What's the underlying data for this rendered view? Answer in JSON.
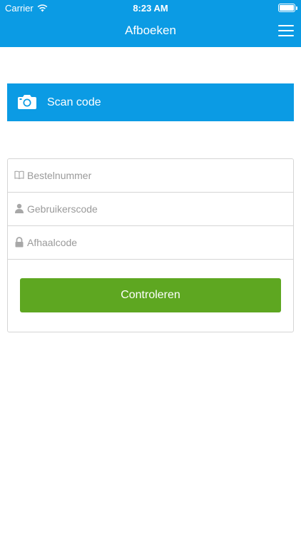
{
  "status_bar": {
    "carrier": "Carrier",
    "time": "8:23 AM",
    "wifi_icon": "wifi-icon",
    "battery_icon": "battery-icon"
  },
  "navbar": {
    "title": "Afboeken",
    "menu_icon": "hamburger-menu-icon"
  },
  "scan": {
    "label": "Scan code",
    "icon": "camera-icon"
  },
  "form": {
    "fields": [
      {
        "placeholder": "Bestelnummer",
        "value": "",
        "icon": "book-icon"
      },
      {
        "placeholder": "Gebruikerscode",
        "value": "",
        "icon": "user-icon"
      },
      {
        "placeholder": "Afhaalcode",
        "value": "",
        "icon": "lock-icon"
      }
    ],
    "submit_label": "Controleren"
  },
  "colors": {
    "primary": "#0b9be4",
    "success": "#5ea721",
    "border": "#d5d5d5",
    "placeholder": "#9a9a9a"
  }
}
